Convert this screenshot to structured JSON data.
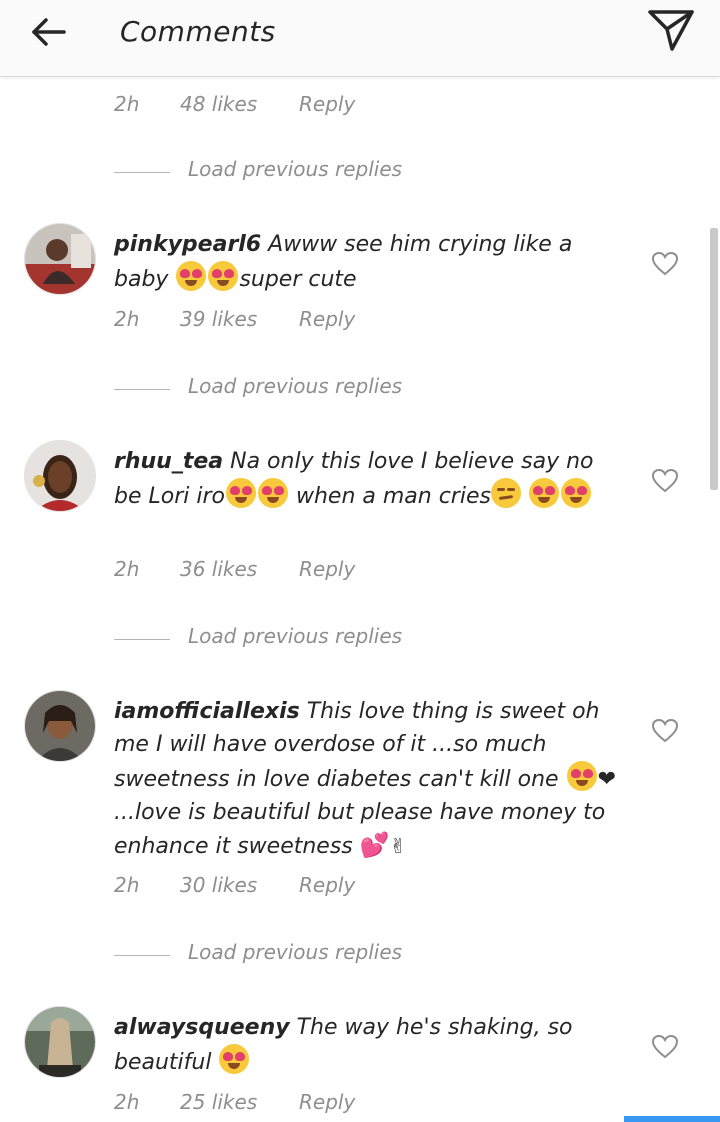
{
  "header": {
    "title": "Comments",
    "back_icon": "arrow-left-icon",
    "send_icon": "paper-plane-icon"
  },
  "load_previous_label": "Load previous replies",
  "top_meta": {
    "time": "2h",
    "likes": "48 likes",
    "reply": "Reply"
  },
  "comments": [
    {
      "username": "pinkypearl6",
      "text_1": "Awww see him crying like a baby ",
      "text_2": "super cute",
      "time": "2h",
      "likes": "39 likes",
      "reply": "Reply"
    },
    {
      "username": "rhuu_tea",
      "text_1": "Na only this love I believe say no be Lori iro",
      "text_2": " when a man cries",
      "time": "2h",
      "likes": "36 likes",
      "reply": "Reply"
    },
    {
      "username": "iamofficiallexis",
      "text_1": "This love thing is sweet oh me I will have overdose of it ...so much sweetness in love diabetes can't kill one ",
      "text_2": "...love is beautiful but please have money to enhance it sweetness ",
      "time": "2h",
      "likes": "30 likes",
      "reply": "Reply"
    },
    {
      "username": "alwaysqueeny",
      "text_1": "The way he's shaking, so beautiful ",
      "time": "2h",
      "likes": "25 likes",
      "reply": "Reply"
    }
  ],
  "colors": {
    "text": "#262626",
    "meta": "#8e8e8e",
    "accent": "#3897f0"
  }
}
